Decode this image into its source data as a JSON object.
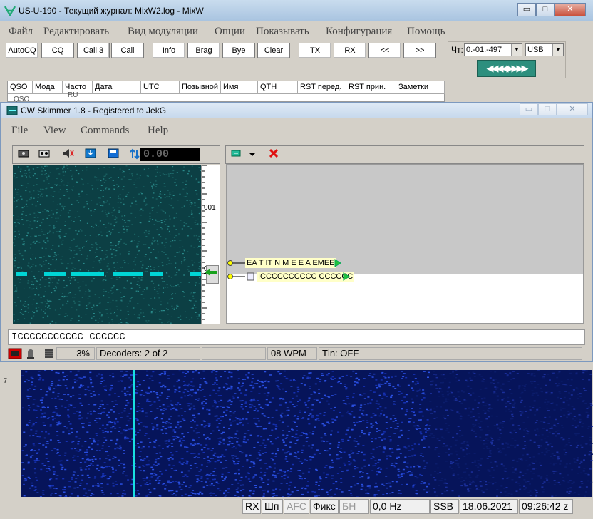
{
  "main_window": {
    "title": "US-U-190 - Текущий журнал: MixW2.log - MixW",
    "min": "▭",
    "max": "□",
    "close": "✕"
  },
  "menu": [
    "Файл",
    "Редактировать",
    "Вид модуляции",
    "Опции",
    "Показывать",
    "Конфигурация",
    "Помощь"
  ],
  "toolbar": [
    "AutoCQ",
    "CQ",
    "Call 3",
    "Call",
    "Info",
    "Brag",
    "Bye",
    "Clear",
    "TX",
    "RX",
    "<<",
    ">>"
  ],
  "right_panel": {
    "label": "Чт:",
    "value": "0.-01.-497",
    "mode": "USB",
    "arrows": "◀◀◀◀▶▶▶▶"
  },
  "log_columns": [
    "QSO",
    "Мода",
    "Часто",
    "Дата",
    "UTC",
    "Позывной",
    "Имя",
    "QTH",
    "RST перед.",
    "RST прин.",
    "Заметки"
  ],
  "log_partial": [
    "QSO",
    "RU"
  ],
  "cw_window": {
    "title": "CW Skimmer 1.8 - Registered to JekG",
    "min": "▭",
    "max": "□",
    "close": "✕"
  },
  "cw_menu": [
    "File",
    "View",
    "Commands",
    "Help"
  ],
  "freq_display": "0.00",
  "scale_labels": [
    "001",
    "000"
  ],
  "decode_lines": [
    "EA T IT N M E E A EMEE",
    "ICCCCCCCCCC CCCCCC"
  ],
  "text_line": "ICCCCCCCCCCC CCCCCC",
  "status": {
    "cpu": "3%",
    "decoders": "Decoders: 2 of 2",
    "wpm": "08 WPM",
    "tln": "Tln: OFF"
  },
  "spec_marker": "7",
  "bottom_status": [
    "RX",
    "Шп",
    "AFC",
    "Фикс",
    "БН",
    "0,0 Hz",
    "",
    "SSB",
    "18.06.2021",
    "09:26:42 z"
  ],
  "colors": {
    "waterfall_dot": "#00d6d6",
    "cw_tone": "#19e0e0",
    "spectrum": "#1638c8"
  }
}
